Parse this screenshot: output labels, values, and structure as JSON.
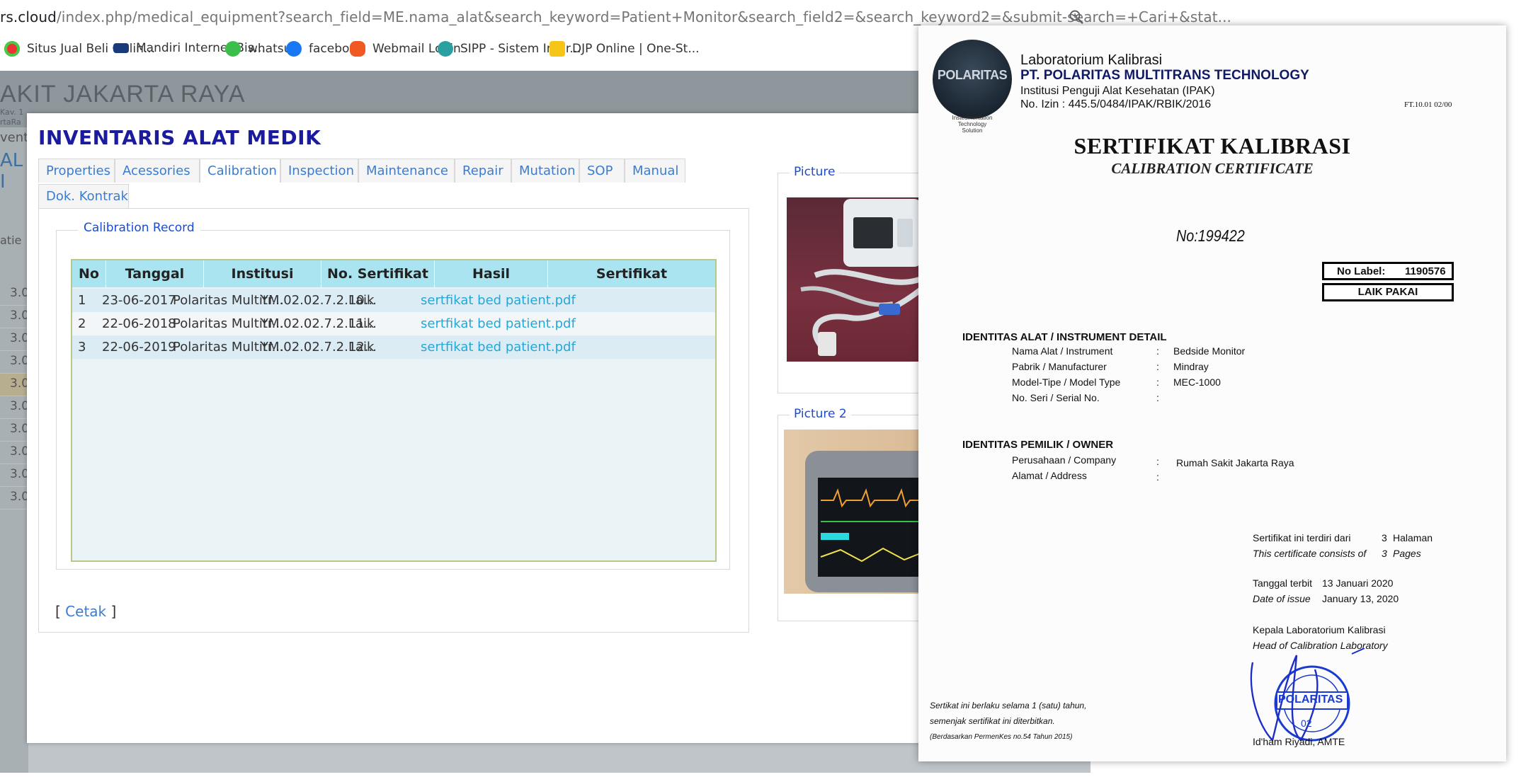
{
  "browser": {
    "url_host": "rs.cloud",
    "url_path": "/index.php/medical_equipment?search_field=ME.nama_alat&search_keyword=Patient+Monitor&search_field2=&search_keyword2=&submit-search=+Cari+&stat...",
    "bookmarks": [
      "Situs Jual Beli Onlin...",
      "Mandiri Internet Bis...",
      "whatsup",
      "facebook",
      "Webmail Login",
      "SIPP - Sistem Infor...",
      "DJP Online | One-St..."
    ]
  },
  "background": {
    "title": "AKIT JAKARTA RAYA",
    "sub1": "Kav. 1",
    "sub2": "rtaRa",
    "side_items": [
      "vent",
      "AL I",
      "atie"
    ],
    "row_values": [
      "3.0",
      "3.0",
      "3.0",
      "3.0",
      "3.0",
      "3.0",
      "3.0",
      "3.0",
      "3.0",
      "3.0",
      "3.0"
    ]
  },
  "modal": {
    "title": "INVENTARIS ALAT MEDIK",
    "tabs": [
      "Properties",
      "Acessories",
      "Calibration",
      "Inspection",
      "Maintenance",
      "Repair",
      "Mutation",
      "SOP",
      "Manual",
      "Dok. Kontrak"
    ],
    "active_tab": "Calibration",
    "record_legend": "Calibration Record",
    "columns": [
      "No",
      "Tanggal",
      "Institusi",
      "No. Sertifikat",
      "Hasil",
      "Sertifikat"
    ],
    "rows": [
      {
        "no": "1",
        "tanggal": "23-06-2017",
        "institusi": "Polaritas Multitr...",
        "sertifikat_no": "YM.02.02.7.2.10...",
        "hasil": "Laik",
        "file": "sertfikat bed patient.pdf"
      },
      {
        "no": "2",
        "tanggal": "22-06-2018",
        "institusi": "Polaritas Multitr...",
        "sertifikat_no": "YM.02.02.7.2.11...",
        "hasil": "Laik",
        "file": "sertfikat bed patient.pdf"
      },
      {
        "no": "3",
        "tanggal": "22-06-2019",
        "institusi": "Polaritas Multitr...",
        "sertifikat_no": "YM.02.02.7.2.12...",
        "hasil": "Laik",
        "file": "sertfikat bed patient.pdf"
      }
    ],
    "cetak_open": "[",
    "cetak_label": "Cetak",
    "cetak_close": "]",
    "picture_label": "Picture",
    "picture2_label": "Picture 2"
  },
  "certificate": {
    "logo_text": "POLARITAS",
    "logo_tagline1": "Insteumentation",
    "logo_tagline2": "Technology",
    "logo_tagline3": "Solution",
    "lab": "Laboratorium Kalibrasi",
    "company": "PT. POLARITAS MULTITRANS TECHNOLOGY",
    "institusi": "Institusi Penguji Alat Kesehatan (IPAK)",
    "izin": "No. Izin : 445.5/0484/IPAK/RBIK/2016",
    "form_code": "FT.10.01 02/00",
    "title": "SERTIFIKAT KALIBRASI",
    "subtitle": "CALIBRATION CERTIFICATE",
    "number": "No:199422",
    "no_label": "No Label:",
    "no_label_value": "1190576",
    "laik_pakai": "LAIK PAKAI",
    "section1": "IDENTITAS ALAT / INSTRUMENT DETAIL",
    "instrument": [
      {
        "label": "Nama Alat / Instrument",
        "value": "Bedside Monitor"
      },
      {
        "label": "Pabrik / Manufacturer",
        "value": "Mindray"
      },
      {
        "label": "Model-Tipe / Model Type",
        "value": "MEC-1000"
      },
      {
        "label": "No. Seri / Serial No.",
        "value": ""
      }
    ],
    "section2": "IDENTITAS PEMILIK / OWNER",
    "owner": [
      {
        "label": "Perusahaan / Company",
        "value": "Rumah Sakit Jakarta Raya"
      },
      {
        "label": "Alamat / Address",
        "value": ""
      }
    ],
    "colon": ":",
    "pages_label": "Sertifikat ini terdiri dari",
    "pages_value": "3",
    "pages_unit": "Halaman",
    "pages_label_en": "This certificate consists of",
    "pages_value_en": "3",
    "pages_unit_en": "Pages",
    "issue_label": "Tanggal terbit",
    "issue_value": "13 Januari 2020",
    "issue_label_en": "Date of issue",
    "issue_value_en": "January 13, 2020",
    "head_label": "Kepala Laboratorium Kalibrasi",
    "head_label_en": "Head of Calibration Laboratory",
    "stamp_text": "POLARITAS",
    "stamp_num": "02",
    "signer": "Id'ham Riyadi, AMTE",
    "validity1": "Sertikat ini berlaku selama 1 (satu) tahun,",
    "validity2": "semenjak sertifikat ini diterbitkan.",
    "validity3": "(Berdasarkan PermenKes no.54 Tahun 2015)"
  }
}
